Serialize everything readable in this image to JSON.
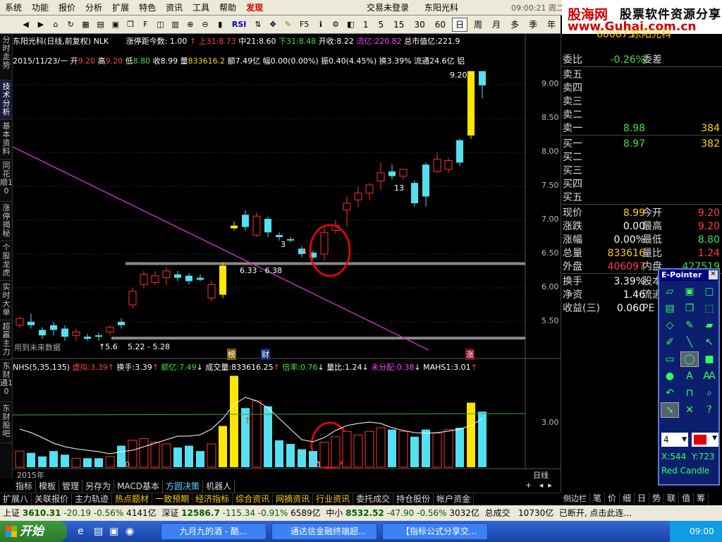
{
  "menu": {
    "items": [
      "系统",
      "功能",
      "报价",
      "分析",
      "扩展",
      "特色",
      "资讯",
      "工具",
      "帮助"
    ],
    "discover": "发现",
    "login_status": "交易未登录",
    "stock_name": "东阳光科",
    "time": "09:00:21 周二"
  },
  "logo": {
    "brand": "股海网",
    "slogan": "股票软件资源分享",
    "url": "www.Guhai.com.cn"
  },
  "toolbar": {
    "rsi": "RSI",
    "fs": "F5",
    "periods": [
      "1",
      "5",
      "15",
      "30",
      "60",
      "日",
      "周",
      "月",
      "多",
      "季",
      "年"
    ]
  },
  "left_tabs": [
    "分时走势",
    "技术分析",
    "基本资料",
    "同花顺10",
    "涨停揭秘",
    "个股龙虎",
    "实时大单",
    "超赢主力",
    "东财通10",
    "东财股吧"
  ],
  "chart": {
    "title_name": "东阳光科(日线,前复权) NLK",
    "limit_days_label": "涨停距今数:",
    "limit_days": "1.00",
    "upper_label": "上31:",
    "upper": "8.73",
    "mid_label": "中21:",
    "mid": "8.60",
    "lower_label": "下31:",
    "lower": "8.48",
    "open_label": "开收:",
    "open": "8.22",
    "float_cap_label": "流亿:",
    "float_cap": "220.82",
    "total_cap_label": "总市值亿:",
    "total_cap": "221.9",
    "date": "2015/11/23/一",
    "open_k": "开",
    "open_v": "9.20",
    "high_k": "高",
    "high_v": "9.20",
    "low_k": "低",
    "low_v": "8.80",
    "close_k": "收",
    "close_v": "8.99",
    "vol_k": "量",
    "vol_v": "833616.2",
    "amt_k": "额",
    "amt_v": "7.49亿",
    "chg_k": "幅",
    "chg_v": "0.00(0.00%)",
    "amp_k": "振",
    "amp_v": "0.40(4.45%)",
    "turn_k": "换",
    "turn_v": "3.39%",
    "flow_k": "流通",
    "flow_v": "24.6亿",
    "metal": "铝",
    "label_max": "9.20",
    "label_zone": "6.33 - 6.38",
    "label_zone2": "5.22 - 5.28",
    "label_low": "5.6",
    "label_3": "3",
    "label_13": "13",
    "label_5": "5",
    "future_data": "用到未来数据",
    "tags": [
      "榜",
      "财",
      "涨"
    ],
    "y_ticks": [
      "9.00",
      "8.50",
      "8.00",
      "7.50",
      "7.00",
      "6.50",
      "6.00",
      "5.50"
    ],
    "vol_tick": "3.00",
    "year_label": "2015年",
    "month_10": "10",
    "month_11": "11",
    "daily_label": "日线"
  },
  "chart_data": {
    "type": "candlestick",
    "title": "东阳光科(日线,前复权) NLK",
    "candles": [
      [
        5.45,
        5.55,
        5.4,
        5.58
      ],
      [
        5.5,
        5.45,
        5.4,
        5.62
      ],
      [
        5.38,
        5.3,
        5.25,
        5.42
      ],
      [
        5.45,
        5.38,
        5.3,
        5.5
      ],
      [
        5.4,
        5.28,
        5.22,
        5.45
      ],
      [
        5.3,
        5.35,
        5.22,
        5.4
      ],
      [
        5.28,
        5.25,
        5.22,
        5.32
      ],
      [
        5.3,
        5.28,
        5.22,
        5.34
      ],
      [
        5.35,
        5.42,
        5.3,
        5.45
      ],
      [
        5.5,
        5.45,
        5.4,
        5.55
      ],
      [
        5.75,
        5.95,
        5.7,
        6.0
      ],
      [
        6.05,
        6.2,
        6.0,
        6.25
      ],
      [
        6.08,
        6.18,
        6.05,
        6.25
      ],
      [
        6.15,
        6.25,
        6.05,
        6.3
      ],
      [
        6.2,
        6.15,
        6.1,
        6.25
      ],
      [
        6.18,
        6.1,
        6.05,
        6.22
      ],
      [
        6.15,
        6.12,
        6.1,
        6.2
      ],
      [
        5.85,
        6.05,
        5.8,
        6.1
      ],
      [
        5.9,
        6.33,
        5.85,
        6.38
      ],
      [
        6.88,
        6.92,
        6.85,
        6.98
      ],
      [
        7.08,
        6.9,
        6.85,
        7.15
      ],
      [
        6.78,
        7.06,
        6.75,
        7.12
      ],
      [
        7.02,
        6.82,
        6.75,
        7.05
      ],
      [
        6.78,
        6.75,
        6.7,
        6.82
      ],
      [
        6.72,
        6.7,
        6.68,
        6.75
      ],
      [
        6.58,
        6.5,
        6.45,
        6.62
      ],
      [
        6.52,
        6.45,
        6.42,
        6.55
      ],
      [
        6.5,
        6.82,
        6.4,
        6.9
      ],
      [
        6.85,
        6.92,
        6.8,
        7.0
      ],
      [
        7.15,
        7.25,
        6.9,
        7.35
      ],
      [
        7.3,
        7.4,
        7.2,
        7.5
      ],
      [
        7.4,
        7.52,
        7.3,
        7.55
      ],
      [
        7.58,
        7.7,
        7.45,
        7.85
      ],
      [
        7.72,
        7.65,
        7.6,
        7.82
      ],
      [
        7.65,
        7.75,
        7.6,
        7.75
      ],
      [
        7.55,
        7.25,
        7.2,
        7.58
      ],
      [
        7.82,
        7.35,
        7.2,
        7.85
      ],
      [
        7.72,
        7.9,
        7.7,
        8.0
      ],
      [
        7.75,
        7.88,
        7.7,
        7.92
      ],
      [
        8.18,
        7.85,
        7.8,
        8.2
      ],
      [
        8.25,
        9.2,
        8.2,
        9.2
      ],
      [
        9.2,
        8.99,
        8.8,
        9.2
      ]
    ],
    "volume": [
      0.9,
      0.8,
      0.6,
      0.9,
      0.7,
      0.5,
      0.5,
      0.5,
      0.6,
      1.2,
      1.5,
      1.6,
      1.4,
      1.3,
      1.1,
      1.2,
      0.9,
      1.3,
      2.3,
      5.1,
      3.3,
      3.7,
      3.4,
      1.5,
      1.3,
      1.0,
      0.9,
      1.4,
      1.7,
      2.0,
      1.8,
      2.0,
      2.2,
      2.1,
      2.0,
      1.7,
      2.1,
      1.9,
      2.1,
      2.2,
      3.6,
      3.1
    ],
    "y_range": [
      5.0,
      9.5
    ]
  },
  "indicator": {
    "name": "NHS(5,35,135)",
    "items": [
      {
        "k": "虚拟:",
        "v": "3.39"
      },
      {
        "k": "换手:",
        "v": "3.39"
      },
      {
        "k": "额亿:",
        "v": "7.49"
      },
      {
        "k": "成交量:",
        "v": "833616.25"
      },
      {
        "k": "倍率:",
        "v": "0.76"
      },
      {
        "k": "量比:",
        "v": "1.24"
      },
      {
        "k": "未分配:",
        "v": "0.38"
      },
      {
        "k": "MAHS1:",
        "v": "3.01"
      }
    ]
  },
  "quote": {
    "code": "600673",
    "name": "东阳光科",
    "weibi_label": "委比",
    "weibi": "-0.26%",
    "weicha_label": "委差",
    "sell": [
      "卖五",
      "卖四",
      "卖三",
      "卖二",
      "卖一"
    ],
    "sell1_price": "8.98",
    "sell1_vol": "384",
    "buy": [
      "买一",
      "买二",
      "买三",
      "买四",
      "买五"
    ],
    "buy1_price": "8.97",
    "buy1_vol": "382",
    "rows": [
      {
        "k": "现价",
        "v": "8.99",
        "k2": "今开",
        "v2": "9.20"
      },
      {
        "k": "涨跌",
        "v": "0.00",
        "k2": "最高",
        "v2": "9.20"
      },
      {
        "k": "涨幅",
        "v": "0.00%",
        "k2": "最低",
        "v2": "8.80"
      },
      {
        "k": "总量",
        "v": "833616",
        "k2": "量比",
        "v2": "1.24"
      },
      {
        "k": "外盘",
        "v": "406097",
        "k2": "内盘",
        "v2": "427519"
      },
      {
        "k": "换手",
        "v": "3.39%",
        "k2": "股本",
        "v2": ""
      },
      {
        "k": "净资",
        "v": "1.46",
        "k2": "流通",
        "v2": ""
      },
      {
        "k": "收益(三)",
        "v": "0.060",
        "k2": "PE",
        "v2": ""
      }
    ]
  },
  "bottom_tabs": [
    "指标",
    "模板",
    "管理",
    "另存为",
    "MACD基本",
    "方圆决策",
    "机器人"
  ],
  "bar2": [
    "扩展八",
    "关联报价",
    "主力轨迹",
    "热点题材",
    "一致预期",
    "经济指标",
    "综合资讯",
    "网摘资讯",
    "行业资讯",
    "委托成交",
    "持仓股份",
    "帐户资金"
  ],
  "side_tabs": [
    "侧边栏",
    "笔",
    "价",
    "细",
    "日",
    "势",
    "联",
    "值",
    "筹"
  ],
  "status": {
    "sh_label": "上证",
    "sh_v": "3610.31",
    "sh_c": "-20.19",
    "sh_p": "-0.56%",
    "sh_amt": "4141亿",
    "sz_label": "深证",
    "sz_v": "12586.7",
    "sz_c": "-115.34",
    "sz_p": "-0.91%",
    "sz_amt": "6589亿",
    "zx_label": "中小",
    "zx_v": "8532.52",
    "zx_c": "-47.90",
    "zx_p": "-0.56%",
    "zx_amt": "3032亿",
    "total_label": "总成交",
    "total": "10730亿",
    "conn": "已断开, 点击此连..."
  },
  "taskbar": {
    "start": "开始",
    "tasks": [
      "九月九的酒 - 酷...",
      "通达信金融终端超...",
      "【指标公式分享交..."
    ],
    "clock": "09:00"
  },
  "epointer": {
    "title": "E-Pointer",
    "width": "4",
    "x": "X:544",
    "y": "Y:723",
    "name": "Red Candle"
  }
}
